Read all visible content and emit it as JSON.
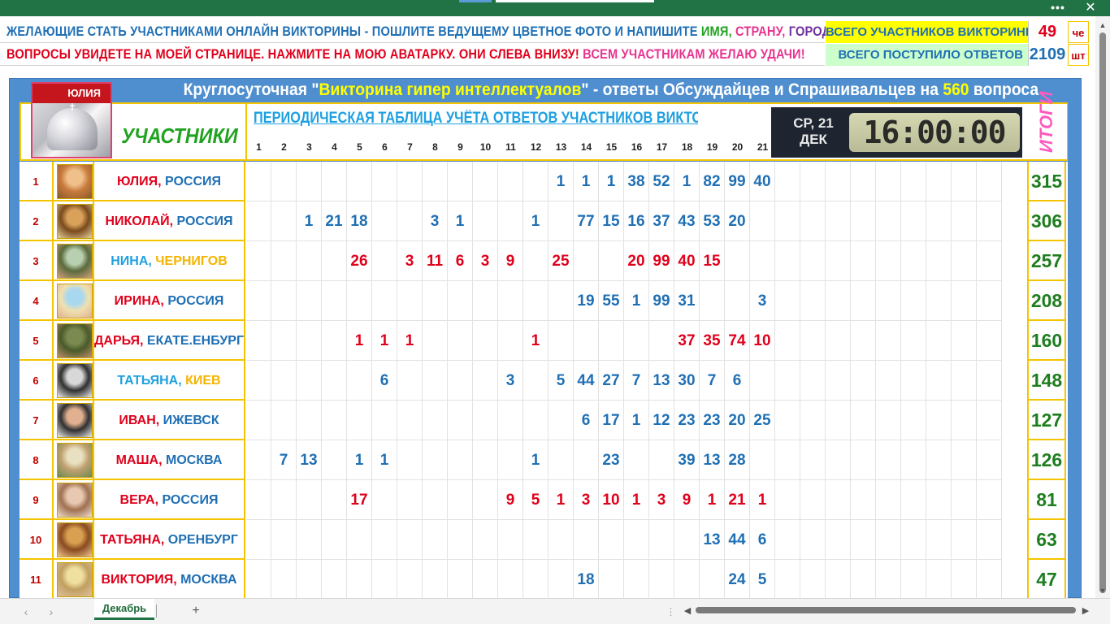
{
  "window": {
    "more_label": "•••",
    "close_label": "✕"
  },
  "banner": {
    "row1": [
      {
        "text": "ЖЕЛАЮЩИЕ  СТАТЬ УЧАСТНИКАМИ ОНЛАЙН ВИКТОРИНЫ  - ПОШЛИТЕ  ВЕДУЩЕМУ ЦВЕТНОЕ  ФОТО  И  НАПИШИТЕ ",
        "color": "blue"
      },
      {
        "text": "ИМЯ, ",
        "color": "green"
      },
      {
        "text": "СТРАНУ, ",
        "color": "pink"
      },
      {
        "text": "ГОРОД.",
        "color": "purple"
      }
    ],
    "row2": [
      {
        "text": "ВОПРОСЫ  УВИДЕТЕ  НА  МОЕЙ  СТРАНИЦЕ.  НАЖМИТЕ  НА  МОЮ  АВАТАРКУ.  ОНИ СЛЕВА  ВНИЗУ! ",
        "color": "red"
      },
      {
        "text": "ВСЕМ  УЧАСТНИКАМ  ЖЕЛАЮ  УДАЧИ!",
        "color": "pink"
      }
    ],
    "stats": {
      "participants_label": "ВСЕГО УЧАСТНИКОВ ВИКТОРИНЫ",
      "participants_value": "49",
      "participants_unit": "че",
      "answers_label": "ВСЕГО ПОСТУПИЛО ОТВЕТОВ",
      "answers_value": "2109",
      "answers_unit": "шт"
    }
  },
  "panel": {
    "title_part1": "Круглосуточная \"",
    "title_highlight": "Викторина гипер интеллектуалов",
    "title_part2": "\" - ответы Обсуждайцев и Спрашивальцев на ",
    "title_count": "560",
    "title_part3": " вопроса",
    "logo_ribbon": "ЮЛИЯ",
    "participants_header": "УЧАСТНИКИ",
    "periodic_header": "ПЕРИОДИЧЕСКАЯ ТАБЛИЦА УЧЁТА ОТВЕТОВ УЧАСТНИКОВ ВИКТОРИНЫ В РАЗРЕЗЕ",
    "clock_day_line1": "СР, 21",
    "clock_day_line2": "ДЕК",
    "clock_time": "16:00:00",
    "totals_header": "ИТОГИ",
    "columns": [
      "1",
      "2",
      "3",
      "4",
      "5",
      "6",
      "7",
      "8",
      "9",
      "10",
      "11",
      "12",
      "13",
      "14",
      "15",
      "16",
      "17",
      "18",
      "19",
      "20",
      "21"
    ]
  },
  "participants": [
    {
      "index": "1",
      "name": "ЮЛИЯ,",
      "name_color": "red",
      "place": "РОССИЯ",
      "place_color": "blue",
      "avatar": [
        "#f0c08a",
        "#c87a3c",
        "#8a5a2e"
      ],
      "total": "315",
      "cells": {
        "13": [
          "1",
          "blue"
        ],
        "14": [
          "1",
          "blue"
        ],
        "15": [
          "1",
          "blue"
        ],
        "16": [
          "38",
          "blue"
        ],
        "17": [
          "52",
          "blue"
        ],
        "18": [
          "1",
          "blue"
        ],
        "19": [
          "82",
          "blue"
        ],
        "20": [
          "99",
          "blue"
        ],
        "21": [
          "40",
          "blue"
        ]
      }
    },
    {
      "index": "2",
      "name": "НИКОЛАЙ,",
      "name_color": "red",
      "place": "РОССИЯ",
      "place_color": "blue",
      "avatar": [
        "#d9a15a",
        "#7a4a1c",
        "#e8d2a0"
      ],
      "total": "306",
      "cells": {
        "3": [
          "1",
          "blue"
        ],
        "4": [
          "21",
          "blue"
        ],
        "5": [
          "18",
          "blue"
        ],
        "8": [
          "3",
          "blue"
        ],
        "9": [
          "1",
          "blue"
        ],
        "12": [
          "1",
          "blue"
        ],
        "14": [
          "77",
          "blue"
        ],
        "15": [
          "15",
          "blue"
        ],
        "16": [
          "16",
          "blue"
        ],
        "17": [
          "37",
          "blue"
        ],
        "18": [
          "43",
          "blue"
        ],
        "19": [
          "53",
          "blue"
        ],
        "20": [
          "20",
          "blue"
        ]
      }
    },
    {
      "index": "3",
      "name": "НИНА,",
      "name_color": "cyan",
      "place": "ЧЕРНИГОВ",
      "place_color": "yellow",
      "avatar": [
        "#b8d0b0",
        "#5a6a3c",
        "#d4a080"
      ],
      "total": "257",
      "cells": {
        "5": [
          "26",
          "red"
        ],
        "7": [
          "3",
          "red"
        ],
        "8": [
          "11",
          "red"
        ],
        "9": [
          "6",
          "red"
        ],
        "10": [
          "3",
          "red"
        ],
        "11": [
          "9",
          "red"
        ],
        "13": [
          "25",
          "red"
        ],
        "16": [
          "20",
          "red"
        ],
        "17": [
          "99",
          "red"
        ],
        "18": [
          "40",
          "red"
        ],
        "19": [
          "15",
          "red"
        ]
      }
    },
    {
      "index": "4",
      "name": "ИРИНА,",
      "name_color": "red",
      "place": "РОССИЯ",
      "place_color": "blue",
      "avatar": [
        "#a8d8f0",
        "#f0e0b0",
        "#e0b090"
      ],
      "total": "208",
      "cells": {
        "14": [
          "19",
          "blue"
        ],
        "15": [
          "55",
          "blue"
        ],
        "16": [
          "1",
          "blue"
        ],
        "17": [
          "99",
          "blue"
        ],
        "18": [
          "31",
          "blue"
        ],
        "21": [
          "3",
          "blue"
        ]
      }
    },
    {
      "index": "5",
      "name": "ДАРЬЯ,",
      "name_color": "red",
      "place": "ЕКАТЕ.ЕНБУРГ",
      "place_color": "blue",
      "avatar": [
        "#7a8a50",
        "#4a5a2a",
        "#c09070"
      ],
      "total": "160",
      "cells": {
        "5": [
          "1",
          "red"
        ],
        "6": [
          "1",
          "red"
        ],
        "7": [
          "1",
          "red"
        ],
        "12": [
          "1",
          "red"
        ],
        "18": [
          "37",
          "red"
        ],
        "19": [
          "35",
          "red"
        ],
        "20": [
          "74",
          "red"
        ],
        "21": [
          "10",
          "red"
        ]
      }
    },
    {
      "index": "6",
      "name": "ТАТЬЯНА,",
      "name_color": "cyan",
      "place": "КИЕВ",
      "place_color": "yellow",
      "avatar": [
        "#d8d8d8",
        "#303030",
        "#f0f0f0"
      ],
      "total": "148",
      "cells": {
        "6": [
          "6",
          "blue"
        ],
        "11": [
          "3",
          "blue"
        ],
        "13": [
          "5",
          "blue"
        ],
        "14": [
          "44",
          "blue"
        ],
        "15": [
          "27",
          "blue"
        ],
        "16": [
          "7",
          "blue"
        ],
        "17": [
          "13",
          "blue"
        ],
        "18": [
          "30",
          "blue"
        ],
        "19": [
          "7",
          "blue"
        ],
        "20": [
          "6",
          "blue"
        ]
      }
    },
    {
      "index": "7",
      "name": "ИВАН,",
      "name_color": "red",
      "place": "ИЖЕВСК",
      "place_color": "blue",
      "avatar": [
        "#e0b090",
        "#303030",
        "#f0f0f0"
      ],
      "total": "127",
      "cells": {
        "14": [
          "6",
          "blue"
        ],
        "15": [
          "17",
          "blue"
        ],
        "16": [
          "1",
          "blue"
        ],
        "17": [
          "12",
          "blue"
        ],
        "18": [
          "23",
          "blue"
        ],
        "19": [
          "23",
          "blue"
        ],
        "20": [
          "20",
          "blue"
        ],
        "21": [
          "25",
          "blue"
        ]
      }
    },
    {
      "index": "8",
      "name": "МАША,",
      "name_color": "red",
      "place": "МОСКВА",
      "place_color": "blue",
      "avatar": [
        "#e8e0c0",
        "#c0a070",
        "#6a8a50"
      ],
      "total": "126",
      "cells": {
        "2": [
          "7",
          "blue"
        ],
        "3": [
          "13",
          "blue"
        ],
        "5": [
          "1",
          "blue"
        ],
        "6": [
          "1",
          "blue"
        ],
        "12": [
          "1",
          "blue"
        ],
        "15": [
          "23",
          "blue"
        ],
        "18": [
          "39",
          "blue"
        ],
        "19": [
          "13",
          "blue"
        ],
        "20": [
          "28",
          "blue"
        ]
      }
    },
    {
      "index": "9",
      "name": "ВЕРА,",
      "name_color": "red",
      "place": "РОССИЯ",
      "place_color": "blue",
      "avatar": [
        "#e8c8b0",
        "#a07050",
        "#f0e0d0"
      ],
      "total": "81",
      "cells": {
        "5": [
          "17",
          "red"
        ],
        "11": [
          "9",
          "red"
        ],
        "12": [
          "5",
          "red"
        ],
        "13": [
          "1",
          "red"
        ],
        "14": [
          "3",
          "red"
        ],
        "15": [
          "10",
          "red"
        ],
        "16": [
          "1",
          "red"
        ],
        "17": [
          "3",
          "red"
        ],
        "18": [
          "9",
          "red"
        ],
        "19": [
          "1",
          "red"
        ],
        "20": [
          "21",
          "red"
        ],
        "21": [
          "1",
          "red"
        ]
      }
    },
    {
      "index": "10",
      "name": "ТАТЬЯНА,",
      "name_color": "red",
      "place": "ОРЕНБУРГ",
      "place_color": "blue",
      "avatar": [
        "#d8a050",
        "#8a4a20",
        "#f0c890"
      ],
      "total": "63",
      "cells": {
        "19": [
          "13",
          "blue"
        ],
        "20": [
          "44",
          "blue"
        ],
        "21": [
          "6",
          "blue"
        ]
      }
    },
    {
      "index": "11",
      "name": "ВИКТОРИЯ,",
      "name_color": "red",
      "place": "МОСКВА",
      "place_color": "blue",
      "avatar": [
        "#f0e0a0",
        "#c0a060",
        "#e0c0a0"
      ],
      "total": "47",
      "cells": {
        "14": [
          "18",
          "blue"
        ],
        "20": [
          "24",
          "blue"
        ],
        "21": [
          "5",
          "blue"
        ]
      }
    }
  ],
  "sheets": {
    "active": "Декабрь",
    "add_label": "+",
    "prev_label": "‹",
    "next_label": "›"
  },
  "colors": {
    "excel_green": "#217346",
    "panel_blue": "#4f8fd0",
    "frame_yellow": "#f5c400",
    "text_blue": "#1f6fb4",
    "text_red": "#e0001b",
    "total_green": "#1e7e1e"
  }
}
